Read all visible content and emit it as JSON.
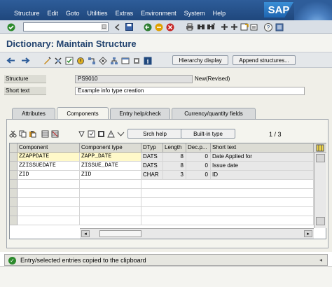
{
  "menubar": {
    "items": [
      "Structure",
      "Edit",
      "Goto",
      "Utilities",
      "Extras",
      "Environment",
      "System",
      "Help"
    ],
    "logo": "SAP"
  },
  "toolbar": {
    "icons": [
      "enter-icon",
      "save-icon",
      "back-icon",
      "exit-icon",
      "cancel-icon",
      "print-icon",
      "find-icon",
      "find-next-icon",
      "first-page-icon",
      "prev-page-icon",
      "next-page-icon",
      "last-page-icon",
      "new-session-icon",
      "shortcut-icon",
      "help-icon"
    ]
  },
  "title": "Dictionary: Maintain Structure",
  "app_toolbar": {
    "hierarchy_label": "Hierarchy display",
    "append_label": "Append structures..."
  },
  "fields": {
    "structure_label": "Structure",
    "structure_value": "PS9010",
    "structure_status": "New(Revised)",
    "short_text_label": "Short text",
    "short_text_value": "Example info type creation"
  },
  "tabs": [
    {
      "label": "Attributes"
    },
    {
      "label": "Components"
    },
    {
      "label": "Entry help/check"
    },
    {
      "label": "Currency/quantity fields"
    }
  ],
  "grid_toolbar": {
    "srch_help_label": "Srch help",
    "builtin_label": "Built-in type",
    "page_counter": "1  /  3"
  },
  "table": {
    "columns": [
      "Component",
      "Component type",
      "DTyp",
      "Length",
      "Dec.p...",
      "Short text"
    ],
    "rows": [
      {
        "component": "ZZAPPDATE",
        "type": "ZAPP_DATE",
        "dtyp": "DATS",
        "length": "8",
        "decp": "0",
        "short": "Date Applied for"
      },
      {
        "component": "ZZISSUEDATE",
        "type": "ZISSUE_DATE",
        "dtyp": "DATS",
        "length": "8",
        "decp": "0",
        "short": "Issue date"
      },
      {
        "component": "ZID",
        "type": "ZID",
        "dtyp": "CHAR",
        "length": "3",
        "decp": "0",
        "short": "ID"
      }
    ]
  },
  "status": {
    "message": "Entry/selected entries copied to the clipboard"
  }
}
